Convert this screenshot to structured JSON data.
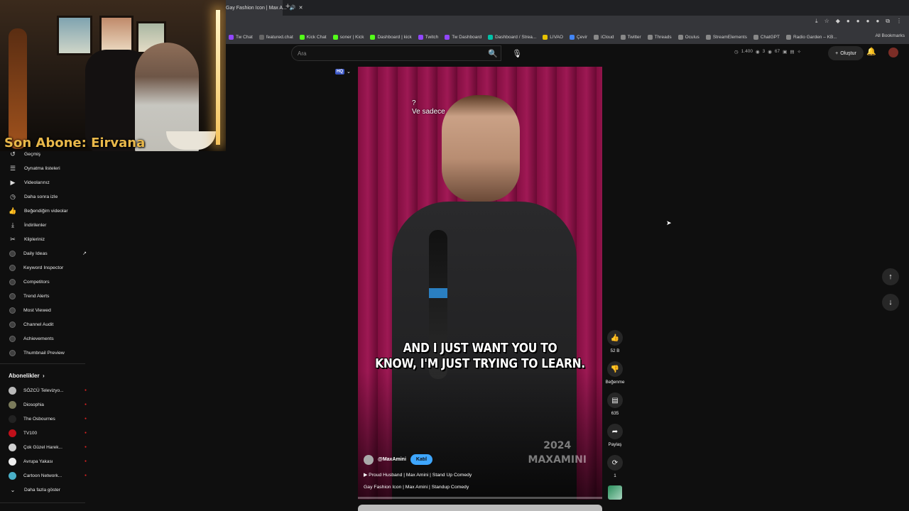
{
  "webcam": {
    "overlay_label": "Son Abone: Eirvana"
  },
  "browser": {
    "tab_title": "Gay Fashion Icon | Max A...",
    "bookmarks": [
      {
        "label": "Tw Chat",
        "color": "#9146ff"
      },
      {
        "label": "featured.chat",
        "color": "#666666"
      },
      {
        "label": "Kick Chat",
        "color": "#53fc18"
      },
      {
        "label": "soner | Kick",
        "color": "#53fc18"
      },
      {
        "label": "Dashboard | kick",
        "color": "#53fc18"
      },
      {
        "label": "Twitch",
        "color": "#9146ff"
      },
      {
        "label": "Tw Dashboard",
        "color": "#9146ff"
      },
      {
        "label": "Dashboard / Strea...",
        "color": "#00c2a8"
      },
      {
        "label": "LIVAO",
        "color": "#e7c200"
      },
      {
        "label": "Çevir",
        "color": "#4285f4"
      },
      {
        "label": "iCloud",
        "color": "#888888"
      },
      {
        "label": "Twitter",
        "color": "#888888"
      },
      {
        "label": "Threads",
        "color": "#888888"
      },
      {
        "label": "Oculus",
        "color": "#888888"
      },
      {
        "label": "StreamElements",
        "color": "#888888"
      },
      {
        "label": "ChatGPT",
        "color": "#888888"
      },
      {
        "label": "Radio Garden – KB...",
        "color": "#888888"
      }
    ],
    "all_bookmarks": "All Bookmarks"
  },
  "header": {
    "search_placeholder": "Ara",
    "stats": [
      "1.400",
      "3",
      "67"
    ],
    "create_label": "Oluştur"
  },
  "sidebar": {
    "items": [
      {
        "label": "Geçmiş",
        "icon": "history-icon",
        "glyph": "↺"
      },
      {
        "label": "Oynatma listeleri",
        "icon": "playlist-icon",
        "glyph": "☰"
      },
      {
        "label": "Videolarınız",
        "icon": "video-icon",
        "glyph": "▶"
      },
      {
        "label": "Daha sonra izle",
        "icon": "clock-icon",
        "glyph": "◷"
      },
      {
        "label": "Beğendiğim videolar",
        "icon": "thumb-up-icon",
        "glyph": "👍"
      },
      {
        "label": "İndirilenler",
        "icon": "download-icon",
        "glyph": "⤓"
      },
      {
        "label": "Klipleriniz",
        "icon": "scissors-icon",
        "glyph": "✂"
      },
      {
        "label": "Daily Ideas",
        "icon": "extension-icon",
        "glyph": ""
      },
      {
        "label": "Keyword Inspector",
        "icon": "extension-icon",
        "glyph": ""
      },
      {
        "label": "Competitors",
        "icon": "extension-icon",
        "glyph": ""
      },
      {
        "label": "Trend Alerts",
        "icon": "extension-icon",
        "glyph": ""
      },
      {
        "label": "Most Viewed",
        "icon": "extension-icon",
        "glyph": ""
      },
      {
        "label": "Channel Audit",
        "icon": "extension-icon",
        "glyph": ""
      },
      {
        "label": "Achievements",
        "icon": "extension-icon",
        "glyph": ""
      },
      {
        "label": "Thumbnail Preview",
        "icon": "extension-icon",
        "glyph": ""
      }
    ],
    "subs_heading": "Abonelikler",
    "subs": [
      {
        "label": "SÖZCÜ Televizyo...",
        "color": "#b8b8b8"
      },
      {
        "label": "Diosophia",
        "color": "#7a7a5a"
      },
      {
        "label": "The Osbournes",
        "color": "#222222"
      },
      {
        "label": "TV100",
        "color": "#c0101a"
      },
      {
        "label": "Çok Güzel Harek...",
        "color": "#d0d0d0"
      },
      {
        "label": "Avrupa Yakası",
        "color": "#eeeeee"
      },
      {
        "label": "Cartoon Network...",
        "color": "#4ab0c8"
      }
    ],
    "show_more": "Daha fazla göster"
  },
  "short": {
    "top_caption_q": "?",
    "top_caption": "Ve sadece",
    "caption_line1": "AND I JUST WANT YOU TO",
    "caption_line2": "KNOW, I'M JUST TRYING TO LEARN.",
    "watermark_year": "2024",
    "watermark_name": "MAXAMINI",
    "channel": "@MaxAmini",
    "join_label": "Katıl",
    "playlist": "Proud Husband | Max Amini | Stand Up Comedy",
    "title": "Gay Fashion Icon | Max Amini | Standup Comedy",
    "hq_label": "HQ"
  },
  "actions": {
    "likes": "52 B",
    "dislike": "Beğenme",
    "comments": "635",
    "share": "Paylaş",
    "remix": "1"
  }
}
